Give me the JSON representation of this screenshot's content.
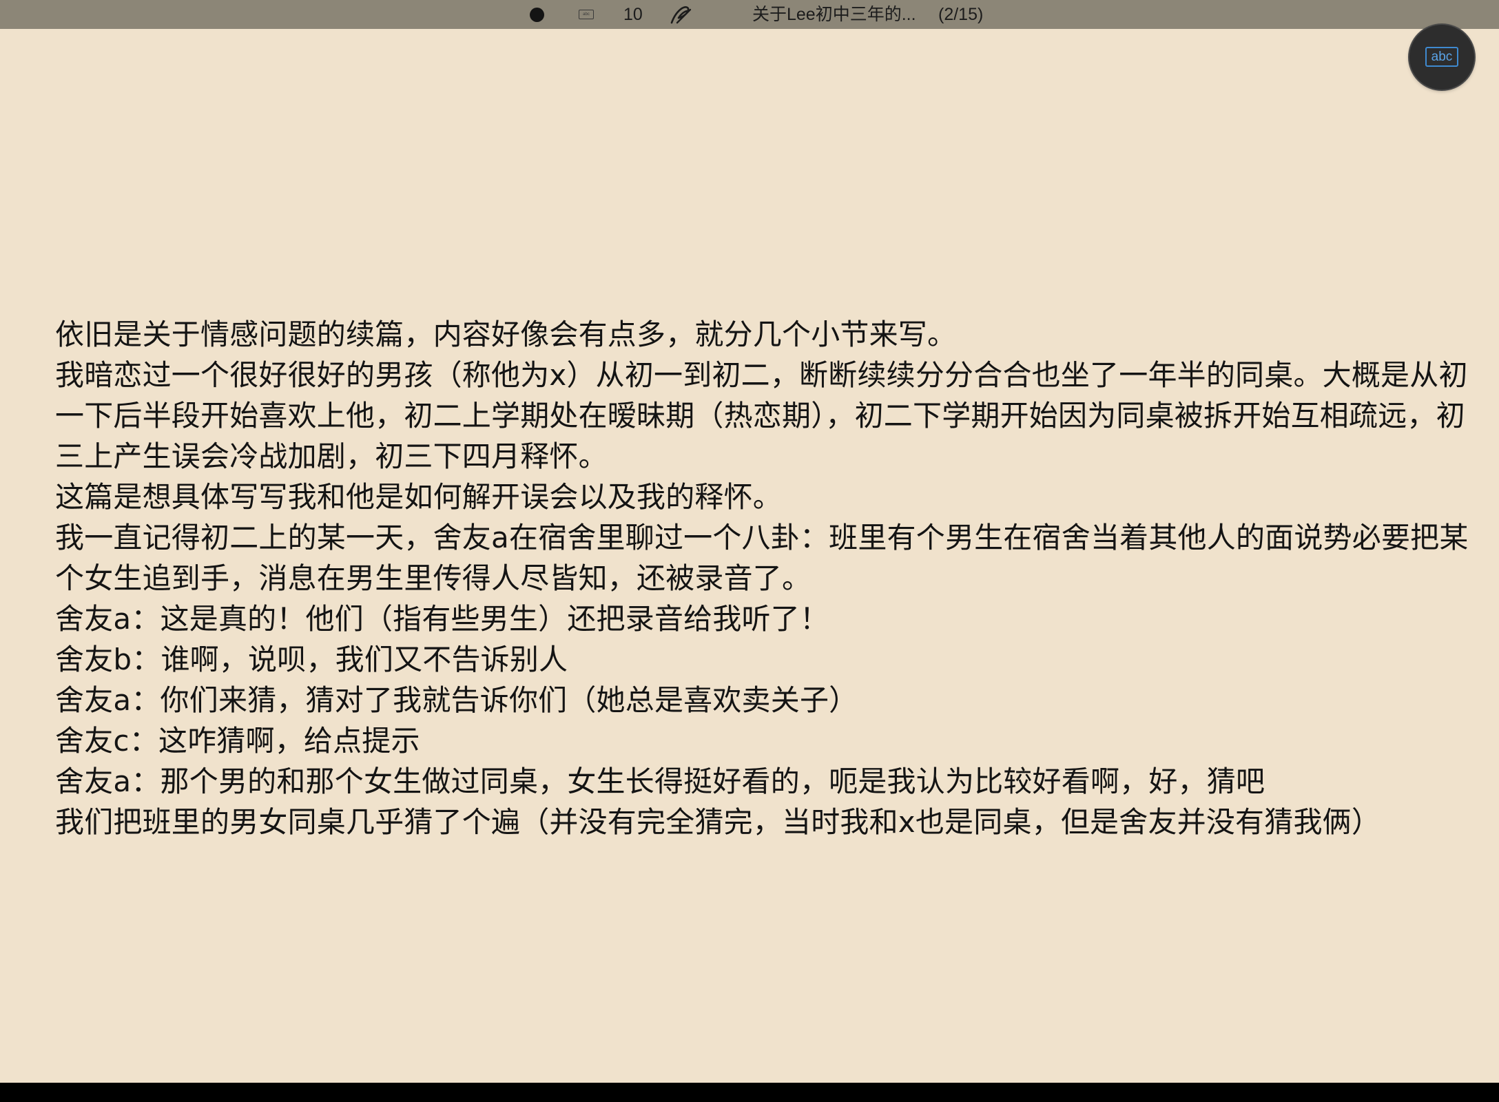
{
  "status_bar": {
    "keyboard_icon_label": "abc",
    "page_count": "10",
    "doc_title": "关于Lee初中三年的...",
    "page_indicator": "(2/15)"
  },
  "floating_button": {
    "label": "abc",
    "icon": "keyboard-abc-icon",
    "accent_color": "#3f8ad0"
  },
  "content": {
    "lines": [
      "依旧是关于情感问题的续篇，内容好像会有点多，就分几个小节来写。",
      "我暗恋过一个很好很好的男孩（称他为x）从初一到初二，断断续续分分合合也坐了一年半的同桌。大概是从初一下后半段开始喜欢上他，初二上学期处在暧昧期（热恋期），初二下学期开始因为同桌被拆开始互相疏远，初三上产生误会冷战加剧，初三下四月释怀。",
      "这篇是想具体写写我和他是如何解开误会以及我的释怀。",
      "我一直记得初二上的某一天，舍友a在宿舍里聊过一个八卦：班里有个男生在宿舍当着其他人的面说势必要把某个女生追到手，消息在男生里传得人尽皆知，还被录音了。",
      "舍友a：这是真的！他们（指有些男生）还把录音给我听了！",
      "舍友b：谁啊，说呗，我们又不告诉别人",
      "舍友a：你们来猜，猜对了我就告诉你们（她总是喜欢卖关子）",
      "舍友c：这咋猜啊，给点提示",
      "舍友a：那个男的和那个女生做过同桌，女生长得挺好看的，呃是我认为比较好看啊，好，猜吧",
      "我们把班里的男女同桌几乎猜了个遍（并没有完全猜完，当时我和x也是同桌，但是舍友并没有猜我俩）"
    ]
  },
  "colors": {
    "page_background": "#f0e2cc",
    "status_bar": "#8c8677",
    "text": "#141414"
  }
}
